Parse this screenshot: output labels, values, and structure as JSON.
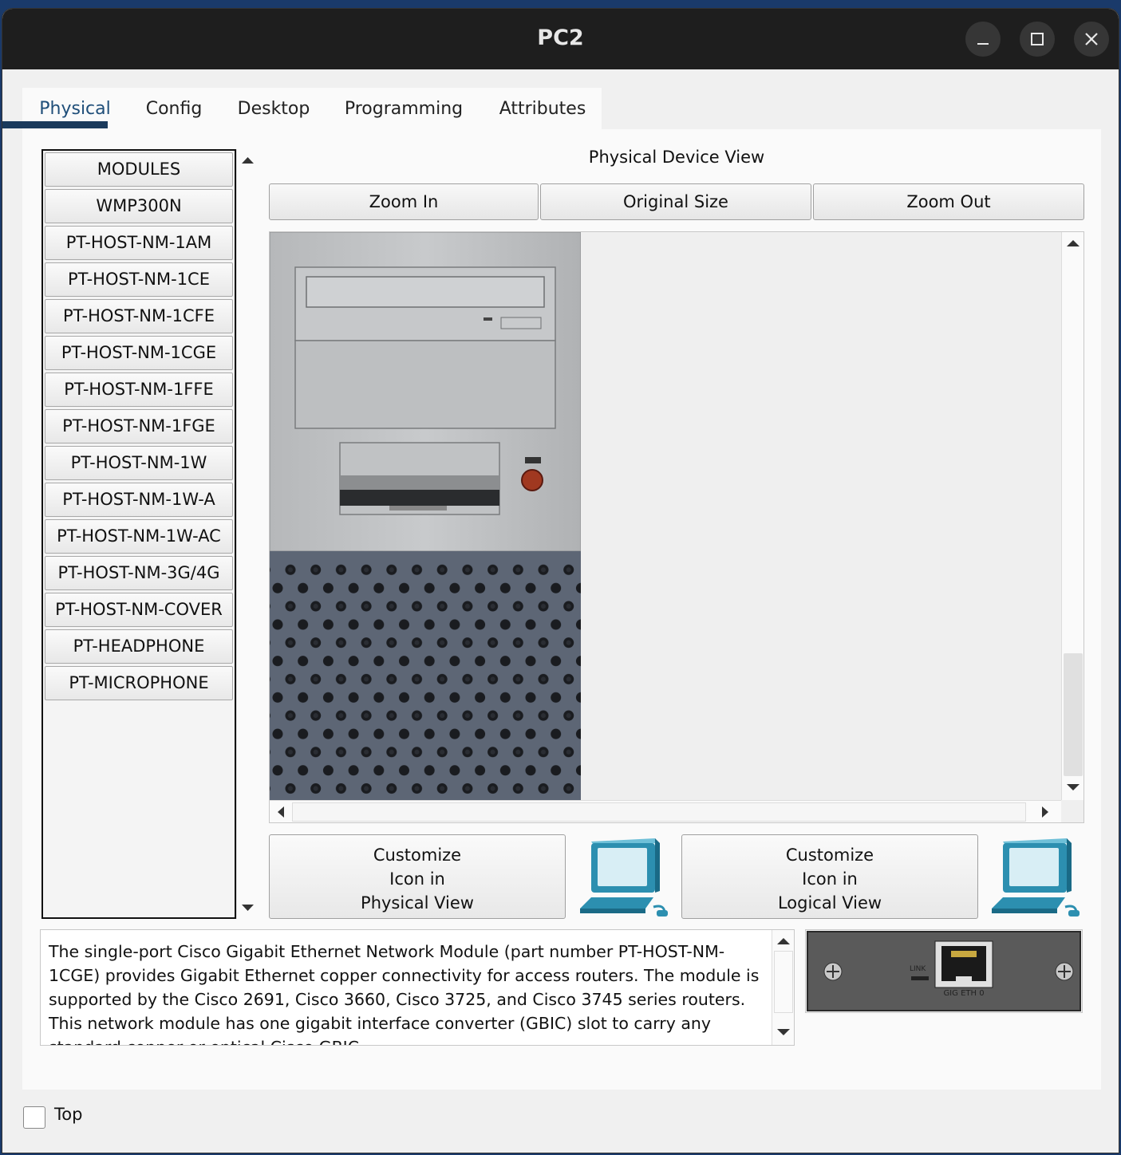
{
  "window": {
    "title": "PC2"
  },
  "tabs": [
    {
      "label": "Physical"
    },
    {
      "label": "Config"
    },
    {
      "label": "Desktop"
    },
    {
      "label": "Programming"
    },
    {
      "label": "Attributes"
    }
  ],
  "modules": [
    "MODULES",
    "WMP300N",
    "PT-HOST-NM-1AM",
    "PT-HOST-NM-1CE",
    "PT-HOST-NM-1CFE",
    "PT-HOST-NM-1CGE",
    "PT-HOST-NM-1FFE",
    "PT-HOST-NM-1FGE",
    "PT-HOST-NM-1W",
    "PT-HOST-NM-1W-A",
    "PT-HOST-NM-1W-AC",
    "PT-HOST-NM-3G/4G",
    "PT-HOST-NM-COVER",
    "PT-HEADPHONE",
    "PT-MICROPHONE"
  ],
  "physical_view": {
    "label": "Physical Device View",
    "zoom_in": "Zoom In",
    "original_size": "Original Size",
    "zoom_out": "Zoom Out"
  },
  "customize": {
    "physical": [
      "Customize",
      "Icon in",
      "Physical View"
    ],
    "logical": [
      "Customize",
      "Icon in",
      "Logical View"
    ]
  },
  "description": "The single-port Cisco Gigabit Ethernet Network Module (part number PT-HOST-NM-1CGE) provides Gigabit Ethernet copper connectivity for access routers. The module is supported by the Cisco 2691, Cisco 3660, Cisco 3725, and Cisco 3745 series routers. This network module has one gigabit interface converter (GBIC) slot to carry any standard copper or optical Cisco GBIC.",
  "module_image": {
    "link_label": "LINK",
    "port_label": "GIG ETH 0"
  },
  "footer": {
    "top_label": "Top"
  },
  "colors": {
    "titlebar": "#1e1e1e",
    "active_tab": "#1a3a5c",
    "chassis_grey": "#c4c6c8",
    "vent_panel": "#5d6675",
    "pc_icon_teal": "#2c8fb0"
  }
}
